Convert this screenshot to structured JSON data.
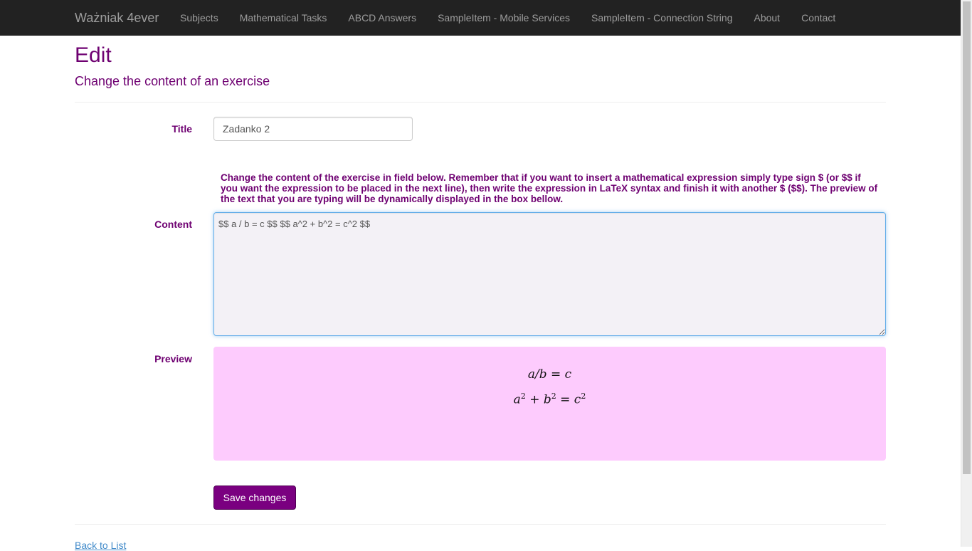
{
  "navbar": {
    "brand": "Ważniak 4ever",
    "items": [
      "Subjects",
      "Mathematical Tasks",
      "ABCD Answers",
      "SampleItem - Mobile Services",
      "SampleItem - Connection String",
      "About",
      "Contact"
    ]
  },
  "page": {
    "title": "Edit",
    "subtitle": "Change the content of an exercise"
  },
  "form": {
    "title_label": "Title",
    "title_value": "Zadanko 2",
    "help_text": "Change the content of the exercise in field below. Remember that if you want to insert a mathematical expression simply type sign $ (or $$ if you want the expression to be placed in the next line), then write the expression in LaTeX syntax and finish it with another $ ($$). The preview of the text that you are typing will be dynamically displayed in the box bellow.",
    "content_label": "Content",
    "content_value": "$$ a / b = c $$ $$ a^2 + b^2 = c^2 $$",
    "preview_label": "Preview",
    "preview_lines": {
      "line1": "a/b = c",
      "line2": {
        "a": "a",
        "exp1": "2",
        "plus": " + b",
        "exp2": "2",
        "eq": " = c",
        "exp3": "2"
      }
    },
    "save_label": "Save changes"
  },
  "footer": {
    "back_link": "Back to List"
  },
  "colors": {
    "accent": "#6e0071",
    "preview_bg": "#fdcbfd",
    "navbar_bg": "#222222"
  }
}
